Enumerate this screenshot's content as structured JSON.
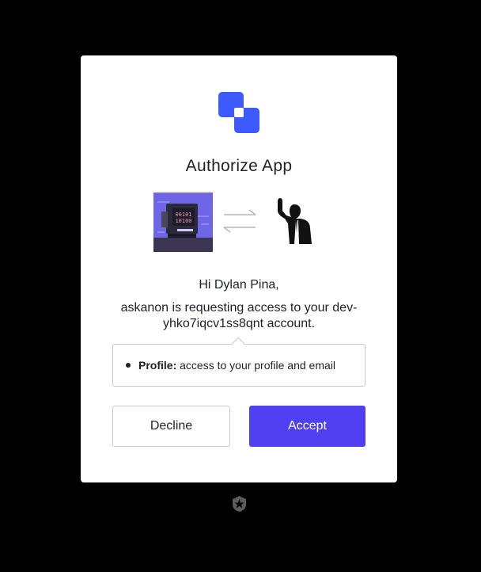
{
  "dialog": {
    "title": "Authorize App",
    "greeting": "Hi Dylan Pina,",
    "request_text": "askanon is requesting access to your dev-yhko7iqcv1ss8qnt account.",
    "scope": {
      "name": "Profile:",
      "description": " access to your profile and email"
    },
    "decline_label": "Decline",
    "accept_label": "Accept",
    "illustration_text": [
      "00101",
      "10100"
    ]
  },
  "colors": {
    "accent": "#4f3ff0",
    "logo_primary": "#3d5afe",
    "background": "#000000",
    "card": "#ffffff"
  },
  "icons": {
    "logo": "app-logo-icon",
    "illustration": "computer-illustration-icon",
    "arrows": "exchange-arrows-icon",
    "avatar": "user-avatar-icon",
    "footer": "auth0-badge-icon"
  }
}
